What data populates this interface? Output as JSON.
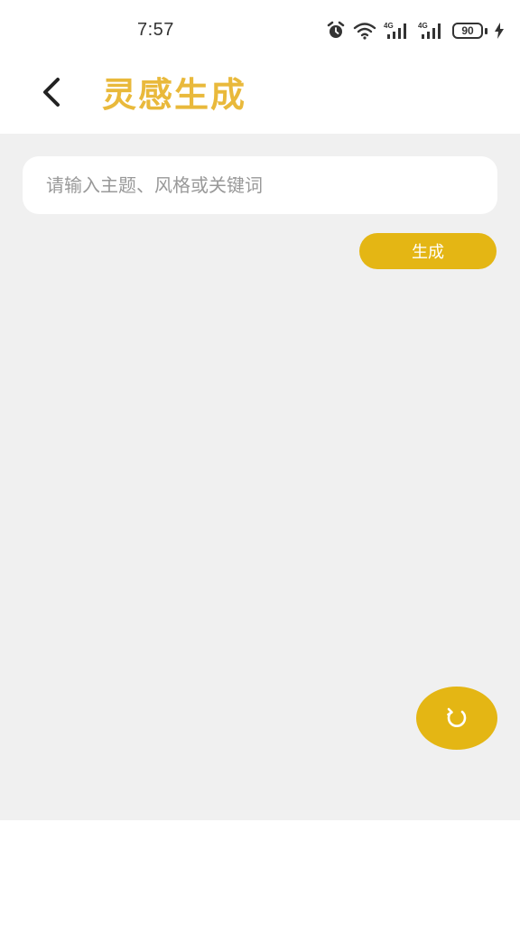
{
  "status_bar": {
    "time": "7:57",
    "battery_level": "90",
    "icons": [
      "alarm-icon",
      "wifi-icon",
      "signal-4g-icon",
      "signal-4g-icon",
      "battery-icon",
      "charging-icon"
    ]
  },
  "header": {
    "title": "灵感生成",
    "back_icon": "chevron-left-icon"
  },
  "search": {
    "value": "",
    "placeholder": "请输入主题、风格或关键词"
  },
  "actions": {
    "generate_label": "生成",
    "refresh_icon": "refresh-icon"
  },
  "colors": {
    "title": "#E9B93B",
    "accent": "#E4B614",
    "content_background": "#F0F0F0",
    "placeholder": "#999999"
  }
}
